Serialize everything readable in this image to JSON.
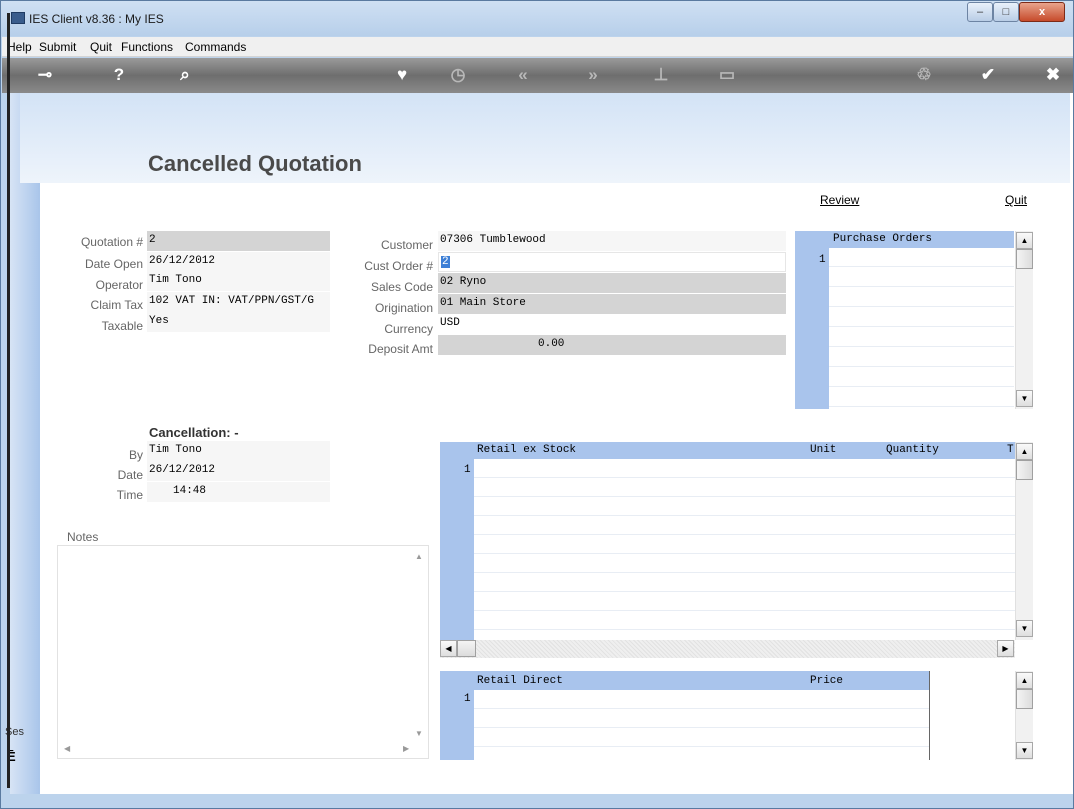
{
  "window": {
    "title": "IES Client v8.36 : My IES",
    "min_label": "–",
    "max_label": "□",
    "close_label": "x"
  },
  "menu": {
    "items": [
      "Help",
      "Submit",
      "Quit",
      "Functions",
      "Commands"
    ]
  },
  "toolbar": {
    "icons": [
      "key-icon",
      "help-icon",
      "search-icon",
      "heart-icon",
      "clock-icon",
      "back-icon",
      "forward-icon",
      "tree-icon",
      "window-icon",
      "recycle-icon",
      "check-icon",
      "close-icon"
    ]
  },
  "page": {
    "title": "Cancelled Quotation",
    "review_link": "Review",
    "quit_link": "Quit"
  },
  "left_fields": [
    {
      "label": "Quotation #",
      "value": "2"
    },
    {
      "label": "Date Open",
      "value": "26/12/2012"
    },
    {
      "label": "Operator",
      "value": "Tim Tono"
    },
    {
      "label": "Claim Tax",
      "value": "102 VAT IN: VAT/PPN/GST/G"
    },
    {
      "label": "Taxable",
      "value": "Yes"
    }
  ],
  "mid_fields": [
    {
      "label": "Customer",
      "value": "07306 Tumblewood"
    },
    {
      "label": "Cust Order #",
      "value": "2"
    },
    {
      "label": "Sales Code",
      "value": "02 Ryno"
    },
    {
      "label": "Origination",
      "value": "01 Main Store"
    },
    {
      "label": "Currency",
      "value": "USD"
    },
    {
      "label": "Deposit Amt",
      "value": "0.00"
    }
  ],
  "purchase_orders": {
    "header": "Purchase Orders",
    "row1": "1"
  },
  "cancellation": {
    "title": "Cancellation: -",
    "by_label": "By",
    "by": "Tim Tono",
    "date_label": "Date",
    "date": "26/12/2012",
    "time_label": "Time",
    "time": "14:48"
  },
  "notes": {
    "label": "Notes"
  },
  "retail_stock": {
    "col1": "Retail ex Stock",
    "col2": "Unit",
    "col3": "Quantity",
    "col4": "T",
    "row1": "1"
  },
  "retail_direct": {
    "col1": "Retail Direct",
    "col2": "Price",
    "row1": "1"
  },
  "sidebar": {
    "session_label": "Ses"
  }
}
